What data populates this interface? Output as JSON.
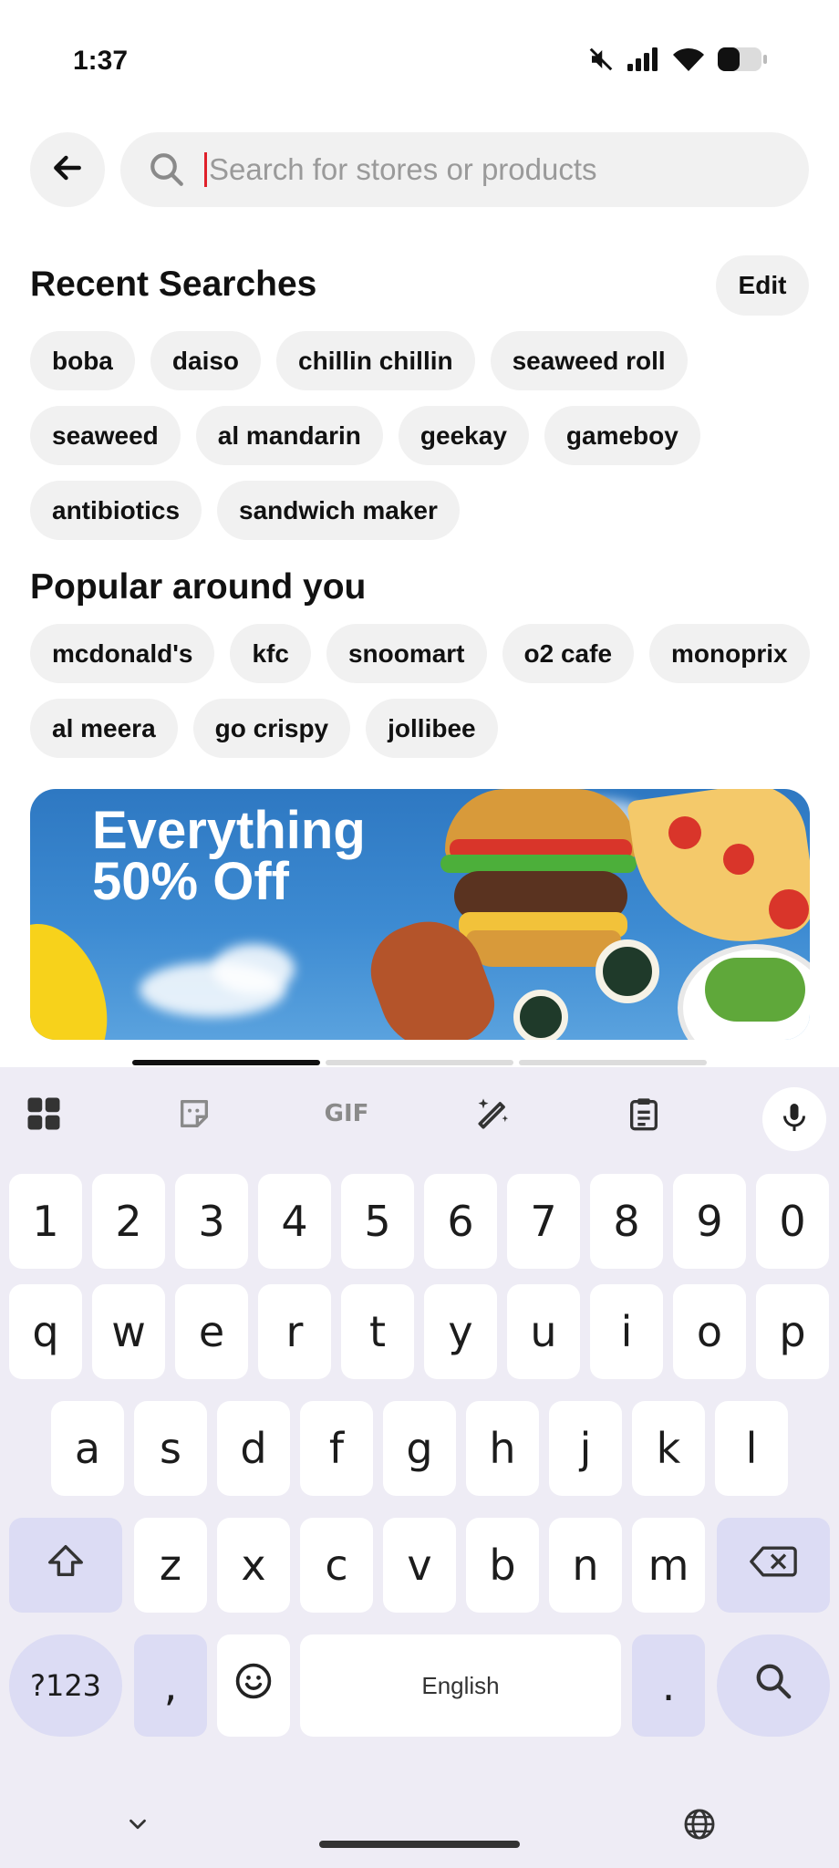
{
  "status_bar": {
    "time": "1:37",
    "icons": [
      "mute-icon",
      "signal-icon",
      "wifi-icon",
      "battery-icon"
    ]
  },
  "search": {
    "placeholder": "Search for stores or products",
    "value": ""
  },
  "recent": {
    "title": "Recent Searches",
    "edit_label": "Edit",
    "items": [
      "boba",
      "daiso",
      "chillin chillin",
      "seaweed roll",
      "seaweed",
      "al mandarin",
      "geekay",
      "gameboy",
      "antibiotics",
      "sandwich maker"
    ]
  },
  "popular": {
    "title": "Popular around you",
    "items": [
      "mcdonald's",
      "kfc",
      "snoomart",
      "o2 cafe",
      "monoprix",
      "al meera",
      "go crispy",
      "jollibee"
    ]
  },
  "banner": {
    "line1": "Everything",
    "line2": "50% Off",
    "pages": 3,
    "active_page": 1
  },
  "keyboard": {
    "toolbar": [
      "apps-icon",
      "sticker-icon",
      "gif-icon",
      "magic-edit-icon",
      "clipboard-icon",
      "mic-icon"
    ],
    "gif_label": "GIF",
    "row_numbers": [
      "1",
      "2",
      "3",
      "4",
      "5",
      "6",
      "7",
      "8",
      "9",
      "0"
    ],
    "row1": [
      "q",
      "w",
      "e",
      "r",
      "t",
      "y",
      "u",
      "i",
      "o",
      "p"
    ],
    "row2": [
      "a",
      "s",
      "d",
      "f",
      "g",
      "h",
      "j",
      "k",
      "l"
    ],
    "row3": [
      "z",
      "x",
      "c",
      "v",
      "b",
      "n",
      "m"
    ],
    "symbols_label": "?123",
    "comma": ",",
    "period": ".",
    "space_label": "English"
  },
  "colors": {
    "chip_bg": "#f1f1f1",
    "caret": "#e0202a",
    "keyboard_bg": "#eeecf5",
    "func_key": "#dcdcf4"
  }
}
